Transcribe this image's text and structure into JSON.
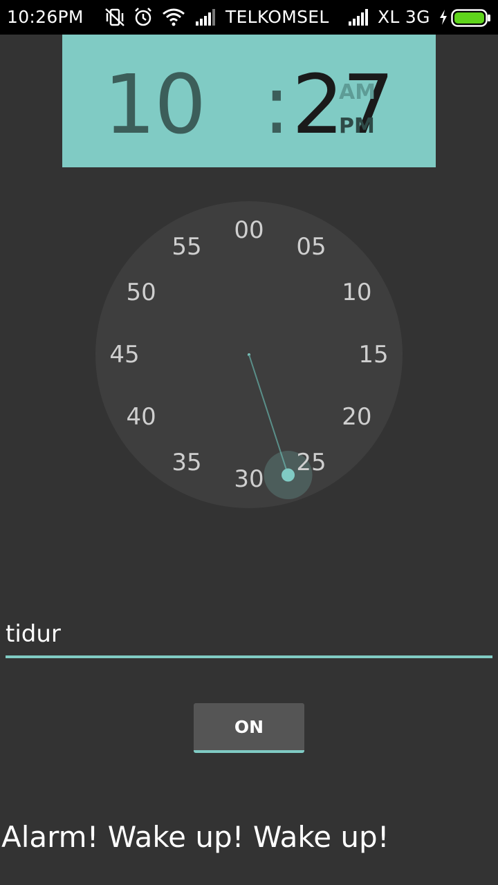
{
  "status_bar": {
    "time": "10:26PM",
    "carrier_1": "TELKOMSEL",
    "carrier_2": "XL 3G",
    "icons": [
      "vibrate-off-icon",
      "alarm-icon",
      "wifi-icon",
      "signal-icon",
      "signal-icon",
      "charging-icon",
      "battery-icon"
    ],
    "battery_color": "#5fd41c"
  },
  "time_header": {
    "hour": "10",
    "separator": ":",
    "minute": "27",
    "am": "AM",
    "pm": "PM",
    "selected_period": "PM",
    "background": "#80cbc4"
  },
  "clock": {
    "numbers": [
      "00",
      "05",
      "10",
      "15",
      "20",
      "25",
      "30",
      "35",
      "40",
      "45",
      "50",
      "55"
    ],
    "selected_minute": 27,
    "accent": "#80cbc4"
  },
  "label_input": {
    "value": "tidur"
  },
  "toggle_button": {
    "label": "ON"
  },
  "message": "Alarm! Wake up! Wake up!"
}
